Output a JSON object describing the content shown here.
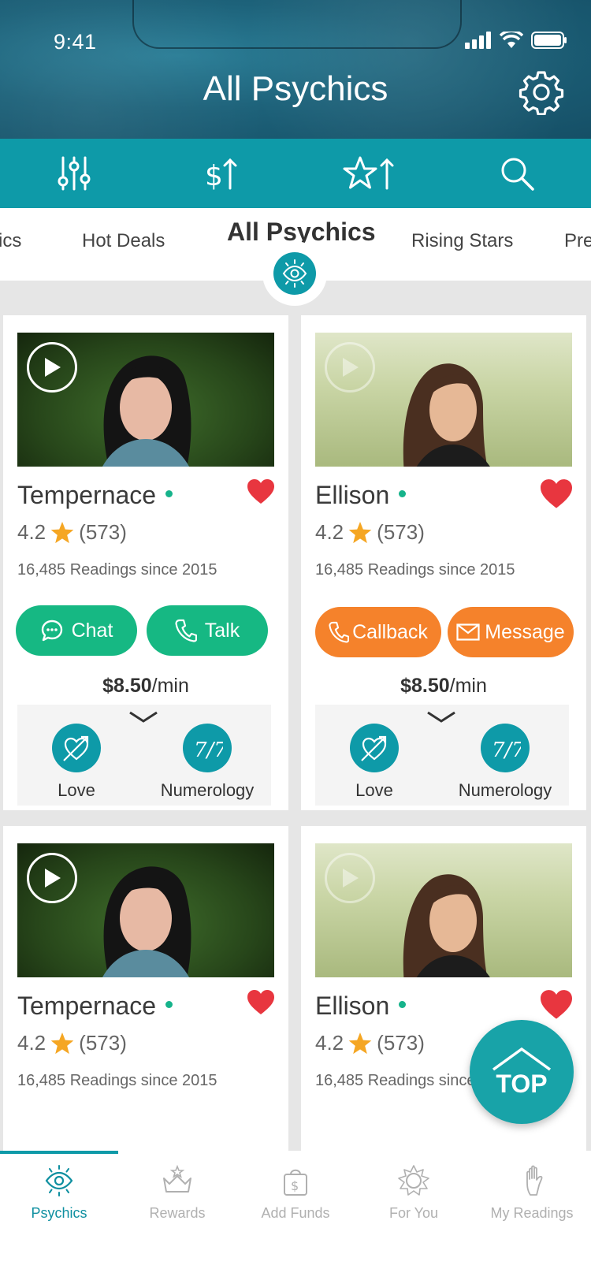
{
  "status_bar": {
    "time": "9:41"
  },
  "header": {
    "title": "All Psychics"
  },
  "toolbar": {
    "icons": [
      "filter-icon",
      "sort-price-icon",
      "sort-rating-icon",
      "search-icon"
    ]
  },
  "categories": {
    "items": [
      "ics",
      "Hot Deals",
      "All Psychics",
      "Rising Stars",
      "Pre"
    ],
    "active": "All Psychics"
  },
  "cards": [
    {
      "name": "Tempernace",
      "rating": "4.2",
      "reviews": "(573)",
      "readings": "16,485 Readings since 2015",
      "buttons": [
        "Chat",
        "Talk"
      ],
      "price": "$8.50",
      "per": "/min",
      "specialties": [
        "Love",
        "Numerology"
      ]
    },
    {
      "name": "Ellison",
      "rating": "4.2",
      "reviews": "(573)",
      "readings": "16,485 Readings since 2015",
      "buttons": [
        "Callback",
        "Message"
      ],
      "price": "$8.50",
      "per": "/min",
      "specialties": [
        "Love",
        "Numerology"
      ]
    },
    {
      "name": "Tempernace",
      "rating": "4.2",
      "reviews": "(573)",
      "readings": "16,485 Readings since 2015"
    },
    {
      "name": "Ellison",
      "rating": "4.2",
      "reviews": "(573)",
      "readings": "16,485 Readings since 20"
    }
  ],
  "top_button": {
    "label": "TOP"
  },
  "bottom_nav": {
    "items": [
      "Psychics",
      "Rewards",
      "Add Funds",
      "For You",
      "My Readings"
    ],
    "active": "Psychics"
  },
  "colors": {
    "teal": "#0e9aa8",
    "green": "#16b883",
    "orange": "#f5822b",
    "heart": "#e8363f",
    "star": "#f5a623"
  }
}
